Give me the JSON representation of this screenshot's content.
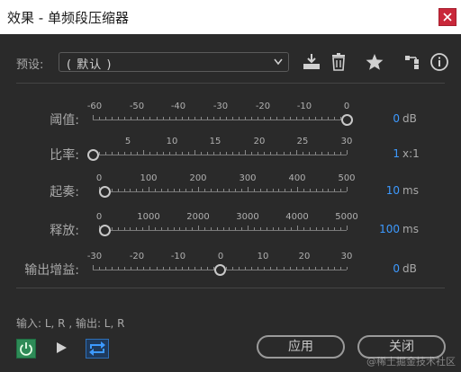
{
  "window": {
    "title": "效果 - 单频段压缩器"
  },
  "preset": {
    "label": "预设:",
    "value": "( 默认 )"
  },
  "toolbar_icons": [
    "download-preset-icon",
    "delete-icon",
    "favorite-star-icon",
    "routing-icon",
    "info-icon"
  ],
  "sliders": [
    {
      "label": "阈值:",
      "ticks": [
        "-60",
        "-50",
        "-40",
        "-30",
        "-20",
        "-10",
        "0"
      ],
      "value": "0",
      "unit": "dB",
      "fraction": 1.0
    },
    {
      "label": "比率:",
      "ticks": [
        "5",
        "10",
        "15",
        "20",
        "25",
        "30"
      ],
      "value": "1",
      "unit": "x:1",
      "fraction": 0.0
    },
    {
      "label": "起奏:",
      "ticks": [
        "0",
        "100",
        "200",
        "300",
        "400",
        "500"
      ],
      "value": "10",
      "unit": "ms",
      "fraction": 0.02
    },
    {
      "label": "释放:",
      "ticks": [
        "0",
        "1000",
        "2000",
        "3000",
        "4000",
        "5000"
      ],
      "value": "100",
      "unit": "ms",
      "fraction": 0.02
    },
    {
      "label": "输出增益:",
      "ticks": [
        "-30",
        "-20",
        "-10",
        "0",
        "10",
        "20",
        "30"
      ],
      "value": "0",
      "unit": "dB",
      "fraction": 0.5
    }
  ],
  "io": {
    "text": "输入: L, R , 输出: L, R"
  },
  "buttons": {
    "apply": "应用",
    "close": "关闭"
  },
  "watermark": "@稀土掘金技术社区",
  "colors": {
    "value_blue": "#3d9aff",
    "power_green": "#2e8b57",
    "close_red": "#c9283a"
  }
}
